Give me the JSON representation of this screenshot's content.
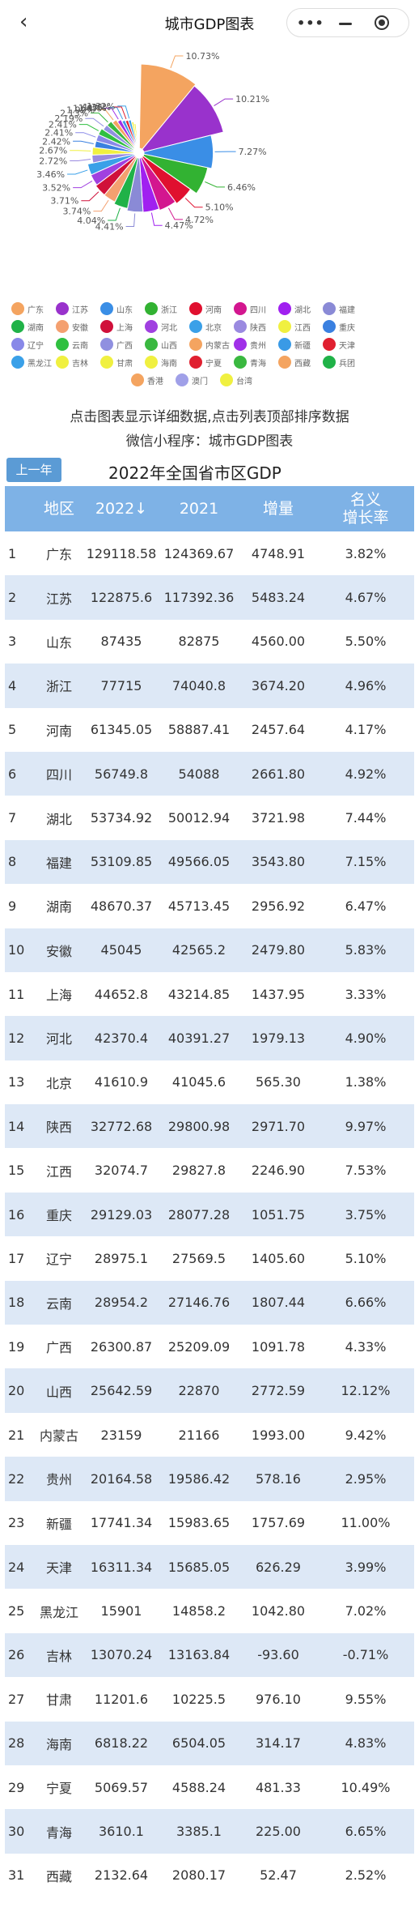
{
  "nav": {
    "title": "城市GDP图表",
    "back_icon": "back-chevron-icon",
    "more_icon": "more-dots-icon",
    "minimize_icon": "minimize-icon",
    "close_icon": "record-close-icon"
  },
  "hint": {
    "line1": "点击图表显示详细数据,点击列表顶部排序数据",
    "line2": "微信小程序：城市GDP图表"
  },
  "controls": {
    "prev_year": "上一年",
    "table_title": "2022年全国省市区GDP"
  },
  "table": {
    "headers": {
      "rank": "",
      "region": "地区",
      "y2022": "2022↓",
      "y2021": "2021",
      "increase": "增量",
      "rate_line1": "名义",
      "rate_line2": "增长率"
    },
    "rows": [
      {
        "rank": "1",
        "region": "广东",
        "y2022": "129118.58",
        "y2021": "124369.67",
        "increase": "4748.91",
        "rate": "3.82%"
      },
      {
        "rank": "2",
        "region": "江苏",
        "y2022": "122875.6",
        "y2021": "117392.36",
        "increase": "5483.24",
        "rate": "4.67%"
      },
      {
        "rank": "3",
        "region": "山东",
        "y2022": "87435",
        "y2021": "82875",
        "increase": "4560.00",
        "rate": "5.50%"
      },
      {
        "rank": "4",
        "region": "浙江",
        "y2022": "77715",
        "y2021": "74040.8",
        "increase": "3674.20",
        "rate": "4.96%"
      },
      {
        "rank": "5",
        "region": "河南",
        "y2022": "61345.05",
        "y2021": "58887.41",
        "increase": "2457.64",
        "rate": "4.17%"
      },
      {
        "rank": "6",
        "region": "四川",
        "y2022": "56749.8",
        "y2021": "54088",
        "increase": "2661.80",
        "rate": "4.92%"
      },
      {
        "rank": "7",
        "region": "湖北",
        "y2022": "53734.92",
        "y2021": "50012.94",
        "increase": "3721.98",
        "rate": "7.44%"
      },
      {
        "rank": "8",
        "region": "福建",
        "y2022": "53109.85",
        "y2021": "49566.05",
        "increase": "3543.80",
        "rate": "7.15%"
      },
      {
        "rank": "9",
        "region": "湖南",
        "y2022": "48670.37",
        "y2021": "45713.45",
        "increase": "2956.92",
        "rate": "6.47%"
      },
      {
        "rank": "10",
        "region": "安徽",
        "y2022": "45045",
        "y2021": "42565.2",
        "increase": "2479.80",
        "rate": "5.83%"
      },
      {
        "rank": "11",
        "region": "上海",
        "y2022": "44652.8",
        "y2021": "43214.85",
        "increase": "1437.95",
        "rate": "3.33%"
      },
      {
        "rank": "12",
        "region": "河北",
        "y2022": "42370.4",
        "y2021": "40391.27",
        "increase": "1979.13",
        "rate": "4.90%"
      },
      {
        "rank": "13",
        "region": "北京",
        "y2022": "41610.9",
        "y2021": "41045.6",
        "increase": "565.30",
        "rate": "1.38%"
      },
      {
        "rank": "14",
        "region": "陕西",
        "y2022": "32772.68",
        "y2021": "29800.98",
        "increase": "2971.70",
        "rate": "9.97%"
      },
      {
        "rank": "15",
        "region": "江西",
        "y2022": "32074.7",
        "y2021": "29827.8",
        "increase": "2246.90",
        "rate": "7.53%"
      },
      {
        "rank": "16",
        "region": "重庆",
        "y2022": "29129.03",
        "y2021": "28077.28",
        "increase": "1051.75",
        "rate": "3.75%"
      },
      {
        "rank": "17",
        "region": "辽宁",
        "y2022": "28975.1",
        "y2021": "27569.5",
        "increase": "1405.60",
        "rate": "5.10%"
      },
      {
        "rank": "18",
        "region": "云南",
        "y2022": "28954.2",
        "y2021": "27146.76",
        "increase": "1807.44",
        "rate": "6.66%"
      },
      {
        "rank": "19",
        "region": "广西",
        "y2022": "26300.87",
        "y2021": "25209.09",
        "increase": "1091.78",
        "rate": "4.33%"
      },
      {
        "rank": "20",
        "region": "山西",
        "y2022": "25642.59",
        "y2021": "22870",
        "increase": "2772.59",
        "rate": "12.12%"
      },
      {
        "rank": "21",
        "region": "内蒙古",
        "y2022": "23159",
        "y2021": "21166",
        "increase": "1993.00",
        "rate": "9.42%"
      },
      {
        "rank": "22",
        "region": "贵州",
        "y2022": "20164.58",
        "y2021": "19586.42",
        "increase": "578.16",
        "rate": "2.95%"
      },
      {
        "rank": "23",
        "region": "新疆",
        "y2022": "17741.34",
        "y2021": "15983.65",
        "increase": "1757.69",
        "rate": "11.00%"
      },
      {
        "rank": "24",
        "region": "天津",
        "y2022": "16311.34",
        "y2021": "15685.05",
        "increase": "626.29",
        "rate": "3.99%"
      },
      {
        "rank": "25",
        "region": "黑龙江",
        "y2022": "15901",
        "y2021": "14858.2",
        "increase": "1042.80",
        "rate": "7.02%"
      },
      {
        "rank": "26",
        "region": "吉林",
        "y2022": "13070.24",
        "y2021": "13163.84",
        "increase": "-93.60",
        "rate": "-0.71%"
      },
      {
        "rank": "27",
        "region": "甘肃",
        "y2022": "11201.6",
        "y2021": "10225.5",
        "increase": "976.10",
        "rate": "9.55%"
      },
      {
        "rank": "28",
        "region": "海南",
        "y2022": "6818.22",
        "y2021": "6504.05",
        "increase": "314.17",
        "rate": "4.83%"
      },
      {
        "rank": "29",
        "region": "宁夏",
        "y2022": "5069.57",
        "y2021": "4588.24",
        "increase": "481.33",
        "rate": "10.49%"
      },
      {
        "rank": "30",
        "region": "青海",
        "y2022": "3610.1",
        "y2021": "3385.1",
        "increase": "225.00",
        "rate": "6.65%"
      },
      {
        "rank": "31",
        "region": "西藏",
        "y2022": "2132.64",
        "y2021": "2080.17",
        "increase": "52.47",
        "rate": "2.52%"
      }
    ]
  },
  "chart_data": {
    "type": "pie",
    "style": "rose",
    "visible_labels": [
      "1.32%",
      "1.36%",
      "1.47%",
      "1.68%",
      "1.92%",
      "2.13%",
      "2.19%",
      "2.41%",
      "2.41%",
      "2.42%",
      "2.67%",
      "2.72%",
      "3.46%",
      "3.52%",
      "3.71%",
      "3.74%",
      "4.04%",
      "4.41%",
      "4.47%",
      "4.72%",
      "5.10%",
      "6.46%",
      "7.27%",
      "10.21%",
      "10.73%"
    ],
    "slices": [
      {
        "name": "广东",
        "value": 10.73,
        "label": "10.73%",
        "color": "#f4a460"
      },
      {
        "name": "江苏",
        "value": 10.21,
        "label": "10.21%",
        "color": "#9932cc"
      },
      {
        "name": "山东",
        "value": 7.27,
        "label": "7.27%",
        "color": "#3a8ee6"
      },
      {
        "name": "浙江",
        "value": 6.46,
        "label": "6.46%",
        "color": "#32b232"
      },
      {
        "name": "河南",
        "value": 5.1,
        "label": "5.10%",
        "color": "#e0102f"
      },
      {
        "name": "四川",
        "value": 4.72,
        "label": "4.72%",
        "color": "#d3168f"
      },
      {
        "name": "湖北",
        "value": 4.47,
        "label": "4.47%",
        "color": "#a020f0"
      },
      {
        "name": "福建",
        "value": 4.41,
        "label": "4.41%",
        "color": "#8a8ad6"
      },
      {
        "name": "湖南",
        "value": 4.04,
        "label": "4.04%",
        "color": "#20b248"
      },
      {
        "name": "安徽",
        "value": 3.74,
        "label": "3.74%",
        "color": "#f4a070"
      },
      {
        "name": "上海",
        "value": 3.71,
        "label": "3.71%",
        "color": "#d0103a"
      },
      {
        "name": "河北",
        "value": 3.52,
        "label": "3.52%",
        "color": "#a040e0"
      },
      {
        "name": "北京",
        "value": 3.46,
        "label": "3.46%",
        "color": "#3aa0e8"
      },
      {
        "name": "陕西",
        "value": 2.72,
        "label": "2.72%",
        "color": "#9a8ae0"
      },
      {
        "name": "江西",
        "value": 2.67,
        "label": "2.67%",
        "color": "#f0f040"
      },
      {
        "name": "重庆",
        "value": 2.42,
        "label": "2.42%",
        "color": "#3a80e0"
      },
      {
        "name": "辽宁",
        "value": 2.41,
        "label": "2.41%",
        "color": "#8888e8"
      },
      {
        "name": "云南",
        "value": 2.41,
        "label": "2.41%",
        "color": "#30c040"
      },
      {
        "name": "广西",
        "value": 2.19,
        "label": "2.19%",
        "color": "#9090e0"
      },
      {
        "name": "山西",
        "value": 2.13,
        "label": "2.13%",
        "color": "#3ab840"
      },
      {
        "name": "内蒙古",
        "value": 1.92,
        "label": "1.92%",
        "color": "#f4a460"
      },
      {
        "name": "贵州",
        "value": 1.68,
        "label": "1.68%",
        "color": "#a030e8"
      },
      {
        "name": "新疆",
        "value": 1.47,
        "label": "1.47%",
        "color": "#3a9ae6"
      },
      {
        "name": "天津",
        "value": 1.36,
        "label": "1.36%",
        "color": "#e02030"
      },
      {
        "name": "黑龙江",
        "value": 1.32,
        "label": "1.32%",
        "color": "#3aa0e8"
      },
      {
        "name": "吉林",
        "value": 1.1,
        "label": "",
        "color": "#f0f040"
      },
      {
        "name": "甘肃",
        "value": 0.94,
        "label": "",
        "color": "#f0f040"
      },
      {
        "name": "海南",
        "value": 0.57,
        "label": "",
        "color": "#f0f040"
      },
      {
        "name": "宁夏",
        "value": 0.42,
        "label": "",
        "color": "#f0f040"
      },
      {
        "name": "青海",
        "value": 0.3,
        "label": "",
        "color": "#f0f040"
      },
      {
        "name": "西藏",
        "value": 0.18,
        "label": "",
        "color": "#f0f040"
      },
      {
        "name": "香港",
        "value": 0.5,
        "label": "",
        "color": "#f4a460"
      },
      {
        "name": "澳门",
        "value": 0.05,
        "label": "",
        "color": "#a0a0e8"
      },
      {
        "name": "台湾",
        "value": 0.1,
        "label": "",
        "color": "#f0f040"
      }
    ]
  },
  "legend": {
    "rows": [
      [
        {
          "label": "广东",
          "color": "#f4a460"
        },
        {
          "label": "江苏",
          "color": "#9932cc"
        },
        {
          "label": "山东",
          "color": "#3a8ee6"
        },
        {
          "label": "浙江",
          "color": "#32b232"
        },
        {
          "label": "河南",
          "color": "#e0102f"
        },
        {
          "label": "四川",
          "color": "#d3168f"
        },
        {
          "label": "湖北",
          "color": "#a020f0"
        },
        {
          "label": "福建",
          "color": "#8a8ad6"
        }
      ],
      [
        {
          "label": "湖南",
          "color": "#20b248"
        },
        {
          "label": "安徽",
          "color": "#f4a070"
        },
        {
          "label": "上海",
          "color": "#d0103a"
        },
        {
          "label": "河北",
          "color": "#a040e0"
        },
        {
          "label": "北京",
          "color": "#3aa0e8"
        },
        {
          "label": "陕西",
          "color": "#9a8ae0"
        },
        {
          "label": "江西",
          "color": "#f0f040"
        },
        {
          "label": "重庆",
          "color": "#3a80e0"
        }
      ],
      [
        {
          "label": "辽宁",
          "color": "#8888e8"
        },
        {
          "label": "云南",
          "color": "#30c040"
        },
        {
          "label": "广西",
          "color": "#9090e0"
        },
        {
          "label": "山西",
          "color": "#3ab840"
        },
        {
          "label": "内蒙古",
          "color": "#f4a460"
        },
        {
          "label": "贵州",
          "color": "#a030e8"
        },
        {
          "label": "新疆",
          "color": "#3a9ae6"
        },
        {
          "label": "天津",
          "color": "#e02030"
        }
      ],
      [
        {
          "label": "黑龙江",
          "color": "#3aa0e8"
        },
        {
          "label": "吉林",
          "color": "#f0f040"
        },
        {
          "label": "甘肃",
          "color": "#f0f040"
        },
        {
          "label": "海南",
          "color": "#f0f040"
        },
        {
          "label": "宁夏",
          "color": "#e02030"
        },
        {
          "label": "青海",
          "color": "#3ab840"
        },
        {
          "label": "西藏",
          "color": "#f4a460"
        },
        {
          "label": "兵团",
          "color": "#20b248"
        }
      ],
      [
        {
          "label": "香港",
          "color": "#f4a460"
        },
        {
          "label": "澳门",
          "color": "#a0a0e8"
        },
        {
          "label": "台湾",
          "color": "#f0f040"
        }
      ]
    ]
  }
}
